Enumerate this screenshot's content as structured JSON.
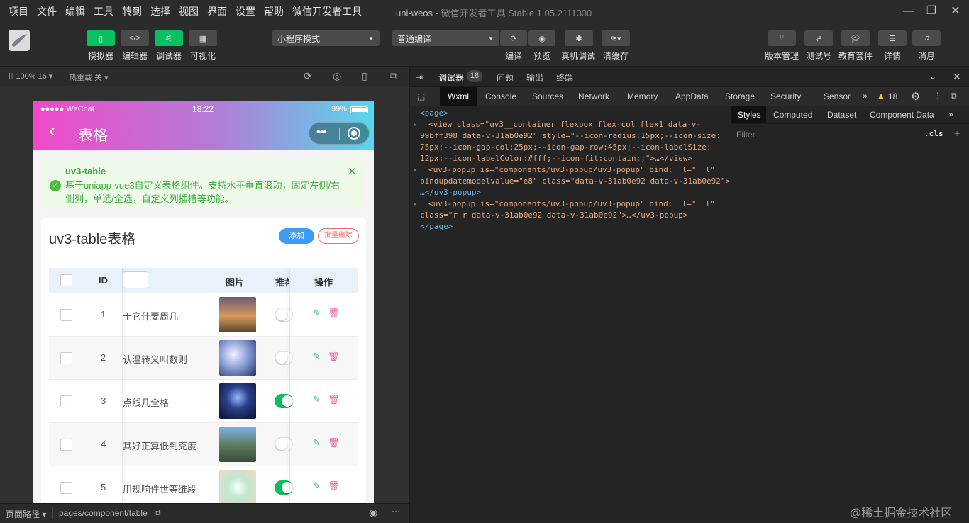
{
  "menu": [
    "项目",
    "文件",
    "编辑",
    "工具",
    "转到",
    "选择",
    "视图",
    "界面",
    "设置",
    "帮助",
    "微信开发者工具"
  ],
  "window_title": {
    "main": "uni-weos",
    "sub": " - 微信开发者工具 Stable 1.05.2111300"
  },
  "toolbar": {
    "simulator": "模拟器",
    "editor": "编辑器",
    "debugger": "调试器",
    "visual": "可视化",
    "mode_select": "小程序模式",
    "compile_select": "普通编译",
    "compile": "编译",
    "preview": "预览",
    "remote_debug": "真机调试",
    "clear_cache": "清缓存",
    "version": "版本管理",
    "test": "测试号",
    "edu": "教育套件",
    "detail": "详情",
    "message": "消息"
  },
  "subbar": {
    "device": "iii 100% 16 ▾",
    "hot_reload": "热重载 关 ▾"
  },
  "phone": {
    "carrier": "●●●●● WeChat",
    "time": "18:22",
    "battery": "99%",
    "nav_title": "表格",
    "notice_title": "uv3-table",
    "notice_text": "基于uniapp-vue3自定义表格组件。支持水平垂直滚动，固定左侧/右侧列，单选/全选，自定义列插槽等功能。",
    "card_title": "uv3-table表格",
    "add_btn": "添加",
    "batch_delete_btn": "批量删除",
    "headers": {
      "id": "ID",
      "image": "图片",
      "recommend": "推荐",
      "action": "操作"
    },
    "rows": [
      {
        "id": "1",
        "title": "于它什要周几",
        "on": false
      },
      {
        "id": "2",
        "title": "认温转义叫数则",
        "on": false
      },
      {
        "id": "3",
        "title": "点线几全格",
        "on": true
      },
      {
        "id": "4",
        "title": "其好正算低到克度",
        "on": false
      },
      {
        "id": "5",
        "title": "用规响件世等维段",
        "on": true
      }
    ]
  },
  "bottom": {
    "path_label": "页面路径 ▾",
    "path": "pages/component/table"
  },
  "devtools": {
    "top_tabs": {
      "debugger": "调试器",
      "count": "18",
      "issues": "问题",
      "output": "输出",
      "terminal": "终端"
    },
    "tabs": [
      "Wxml",
      "Console",
      "Sources",
      "Network",
      "Memory",
      "AppData",
      "Storage",
      "Security",
      "Sensor"
    ],
    "warn_count": "18",
    "side_tabs": [
      "Styles",
      "Computed",
      "Dataset",
      "Component Data"
    ],
    "filter": "Filter",
    "cls": ".cls",
    "code": {
      "l1": "<page>",
      "l2a": "<view class=\"uv3__container flexbox flex-col flex1 data-v-",
      "l2b": "99bff398 data-v-31ab0e92\" style=\"--icon-radius:15px;--icon-size:",
      "l2c": "75px;--icon-gap-col:25px;--icon-gap-row:45px;--icon-labelSize:",
      "l2d": "12px;--icon-labelColor:#fff;--icon-fit:contain;;\">…</view>",
      "l3a": "<uv3-popup is=\"components/uv3-popup/uv3-popup\" bind:__l=\"__l\"",
      "l3b": "bindupdatemodelvalue=\"e8\" class=\"data-v-31ab0e92 data-v-31ab0e92\">",
      "l3c": "…</uv3-popup>",
      "l4a": "<uv3-popup is=\"components/uv3-popup/uv3-popup\" bind:__l=\"__l\"",
      "l4b": "class=\"r r data-v-31ab0e92 data-v-31ab0e92\">…</uv3-popup>",
      "l5": "</page>"
    }
  },
  "watermark": "@稀土掘金技术社区"
}
